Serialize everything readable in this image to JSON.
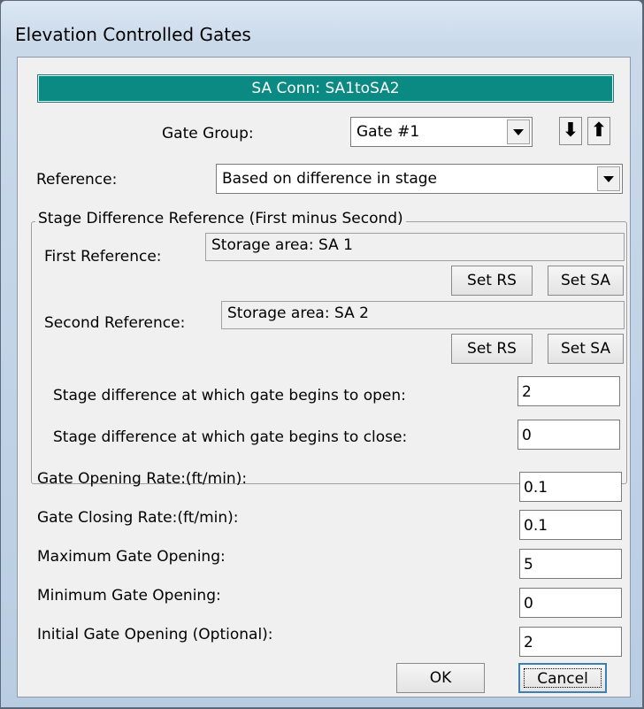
{
  "window": {
    "title": "Elevation Controlled Gates"
  },
  "banner": "SA Conn: SA1toSA2",
  "gate_group": {
    "label": "Gate Group:",
    "value": "Gate #1",
    "down_arrow": "⬇",
    "up_arrow": "⬆"
  },
  "reference": {
    "label": "Reference:",
    "value": "Based on difference in stage"
  },
  "stage_group": {
    "legend": "Stage Difference Reference    (First minus Second)",
    "first_label": "First Reference:",
    "first_value": "Storage area: SA 1",
    "second_label": "Second Reference:",
    "second_value": "Storage area: SA 2",
    "set_rs": "Set RS",
    "set_sa": "Set SA",
    "open_label": "Stage difference at which gate begins to open:",
    "open_value": "2",
    "close_label": "Stage difference at which gate begins to close:",
    "close_value": "0"
  },
  "params": {
    "opening_rate_label": "Gate Opening Rate:(ft/min):",
    "opening_rate_value": "0.1",
    "closing_rate_label": "Gate Closing Rate:(ft/min):",
    "closing_rate_value": "0.1",
    "max_label": "Maximum Gate Opening:",
    "max_value": "5",
    "min_label": "Minimum Gate Opening:",
    "min_value": "0",
    "initial_label": "Initial Gate Opening (Optional):",
    "initial_value": "2"
  },
  "buttons": {
    "ok": "OK",
    "cancel": "Cancel"
  }
}
